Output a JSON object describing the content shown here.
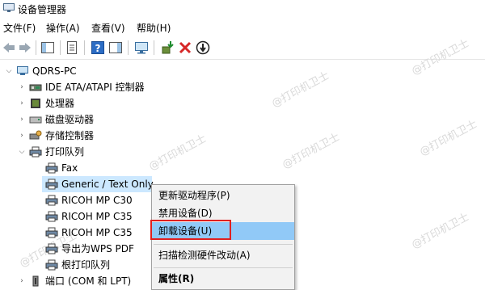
{
  "window": {
    "title": "设备管理器"
  },
  "menu": {
    "items": [
      "文件(F)",
      "操作(A)",
      "查看(V)",
      "帮助(H)"
    ]
  },
  "tree": {
    "root": "QDRS-PC",
    "categories": [
      "IDE ATA/ATAPI 控制器",
      "处理器",
      "磁盘驱动器",
      "存储控制器",
      "打印队列"
    ],
    "print_queue_children": [
      "Fax",
      "Generic / Text Only",
      "RICOH MP C30",
      "RICOH MP C35",
      "RICOH MP C35",
      "导出为WPS PDF",
      "根打印队列"
    ],
    "ports": "端口 (COM 和 LPT)"
  },
  "context_menu": {
    "items": [
      "更新驱动程序(P)",
      "禁用设备(D)",
      "卸载设备(U)",
      "扫描检测硬件改动(A)",
      "属性(R)"
    ],
    "highlighted": "卸载设备(U)"
  },
  "watermark": "@打印机卫士",
  "colors": {
    "selection": "#cce8ff",
    "menu_highlight": "#91c9f7",
    "annotation_box": "#e02020"
  }
}
